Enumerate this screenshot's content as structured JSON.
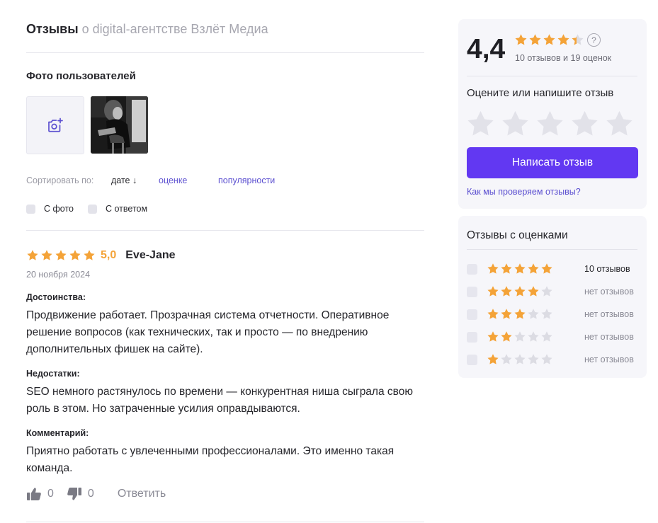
{
  "header": {
    "title": "Отзывы",
    "subtitle": "о digital-агентстве Взлёт Медиа"
  },
  "photos": {
    "title": "Фото пользователей",
    "add_icon": "camera-plus-icon"
  },
  "sort": {
    "label": "Сортировать по:",
    "options": [
      "дате ↓",
      "оценке",
      "популярности"
    ],
    "selected": "дате ↓"
  },
  "filters": [
    "С фото",
    "С ответом"
  ],
  "review": {
    "stars": 5,
    "score": "5,0",
    "author": "Eve-Jane",
    "date": "20 ноября 2024",
    "sections": [
      {
        "title": "Достоинства:",
        "text": "Продвижение работает. Прозрачная система отчетности. Оперативное решение вопросов (как технических, так и просто — по внедрению дополнительных фишек на сайте)."
      },
      {
        "title": "Недостатки:",
        "text": "SEO немного растянулось по времени — конкурентная ниша сыграла свою роль в этом. Но затраченные усилия оправдываются."
      },
      {
        "title": "Комментарий:",
        "text": "Приятно работать с увлеченными профессионалами. Это именно такая команда."
      }
    ],
    "likes": "0",
    "dislikes": "0",
    "reply_label": "Ответить"
  },
  "summary": {
    "score": "4,4",
    "stars_value": 4.4,
    "counts": "10 отзывов и 19 оценок",
    "help_icon": "?",
    "rate_prompt": "Оцените или напишите отзыв",
    "write_button": "Написать отзыв",
    "check_link": "Как мы проверяем отзывы?"
  },
  "distribution": {
    "title": "Отзывы с оценками",
    "rows": [
      {
        "stars": 5,
        "label": "10 отзывов"
      },
      {
        "stars": 4,
        "label": "нет отзывов"
      },
      {
        "stars": 3,
        "label": "нет отзывов"
      },
      {
        "stars": 2,
        "label": "нет отзывов"
      },
      {
        "stars": 1,
        "label": "нет отзывов"
      }
    ]
  },
  "colors": {
    "accent": "#6238f2",
    "link": "#5b4fd0",
    "star": "#f4a338",
    "star_empty": "#dcdce3",
    "muted": "#8a8a95"
  }
}
